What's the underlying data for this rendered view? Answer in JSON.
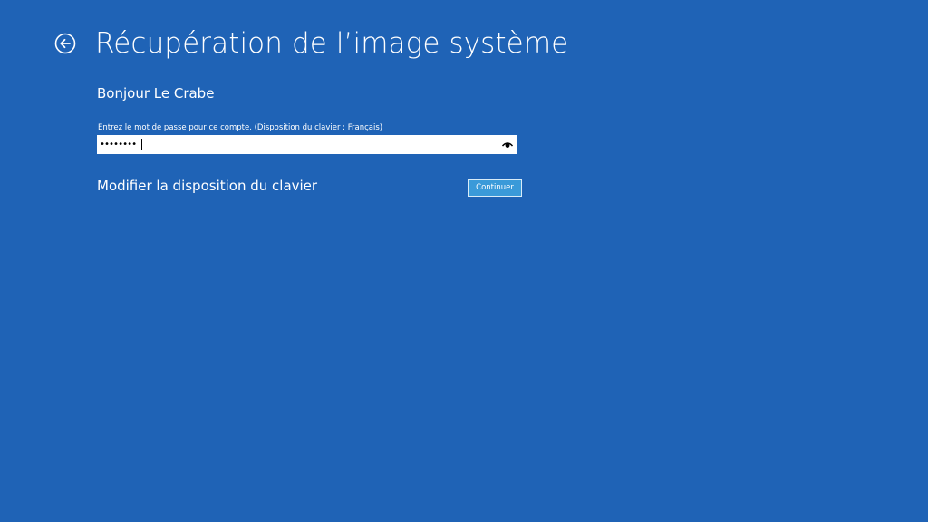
{
  "header": {
    "back_icon": "circle-arrow-left-icon",
    "title": "Récupération de l’image système"
  },
  "greeting": "Bonjour Le Crabe",
  "password": {
    "label": "Entrez le mot de passe pour ce compte. (Disposition du clavier : Français)",
    "value": "••••••••",
    "reveal_icon": "eye-icon"
  },
  "keyboard_link": "Modifier la disposition du clavier",
  "continue_label": "Continuer",
  "colors": {
    "background": "#1f63b6",
    "button": "#3a9ad9",
    "text": "#ffffff"
  }
}
